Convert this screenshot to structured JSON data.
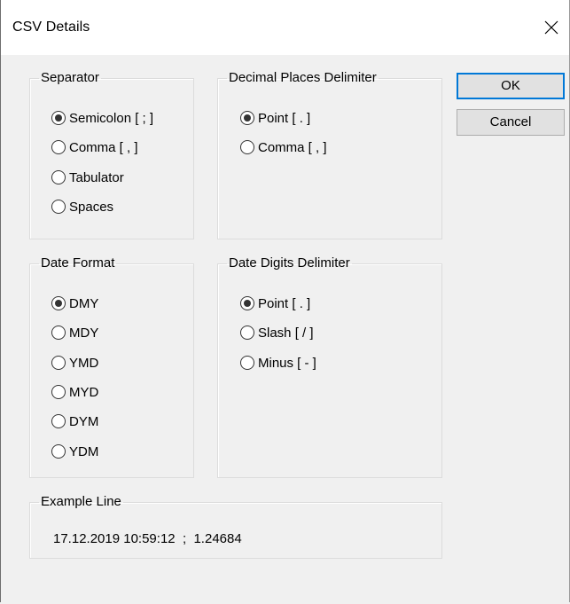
{
  "window": {
    "title": "CSV Details"
  },
  "buttons": {
    "ok": "OK",
    "cancel": "Cancel"
  },
  "separator": {
    "label": "Separator",
    "options": [
      "Semicolon [ ; ]",
      "Comma [ , ]",
      "Tabulator",
      "Spaces"
    ],
    "selected": "Semicolon [ ; ]"
  },
  "decimal": {
    "label": "Decimal Places Delimiter",
    "options": [
      "Point [ . ]",
      "Comma [ , ]"
    ],
    "selected": "Point [ . ]"
  },
  "date_format": {
    "label": "Date Format",
    "options": [
      "DMY",
      "MDY",
      "YMD",
      "MYD",
      "DYM",
      "YDM"
    ],
    "selected": "DMY"
  },
  "date_digits": {
    "label": "Date Digits Delimiter",
    "options": [
      "Point [ . ]",
      "Slash [ / ]",
      "Minus [ - ]"
    ],
    "selected": "Point [ . ]"
  },
  "example": {
    "label": "Example Line",
    "text": "17.12.2019 10:59:12  ;  1.24684"
  }
}
